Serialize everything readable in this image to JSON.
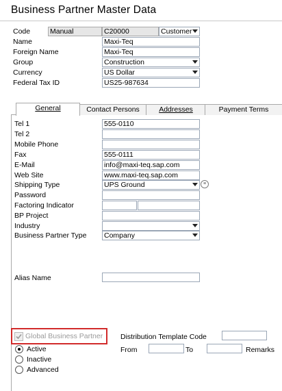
{
  "window": {
    "title": "Business Partner Master Data"
  },
  "header": {
    "code_label": "Code",
    "series_value": "Manual",
    "code_value": "C20000",
    "type_value": "Customer",
    "name_label": "Name",
    "name_value": "Maxi-Teq",
    "foreign_name_label": "Foreign Name",
    "foreign_name_value": "Maxi-Teq",
    "group_label": "Group",
    "group_value": "Construction",
    "currency_label": "Currency",
    "currency_value": "US Dollar",
    "tax_id_label": "Federal Tax ID",
    "tax_id_value": "US25-987634"
  },
  "tabs": [
    {
      "label": "General",
      "active": true
    },
    {
      "label": "Contact Persons",
      "active": false
    },
    {
      "label": "Addresses",
      "active": false
    },
    {
      "label": "Payment Terms",
      "active": false
    }
  ],
  "general": {
    "tel1_label": "Tel 1",
    "tel1_value": "555-0110",
    "tel2_label": "Tel 2",
    "tel2_value": "",
    "mobile_label": "Mobile Phone",
    "mobile_value": "",
    "fax_label": "Fax",
    "fax_value": "555-0111",
    "email_label": "E-Mail",
    "email_value": "info@maxi-teq.sap.com",
    "website_label": "Web Site",
    "website_value": "www.maxi-teq.sap.com",
    "shipping_label": "Shipping Type",
    "shipping_value": "UPS Ground",
    "password_label": "Password",
    "password_value": "",
    "factoring_label": "Factoring Indicator",
    "bp_project_label": "BP Project",
    "bp_project_value": "",
    "industry_label": "Industry",
    "industry_value": "",
    "bp_type_label": "Business Partner Type",
    "bp_type_value": "Company",
    "alias_label": "Alias Name",
    "alias_value": ""
  },
  "bottom": {
    "global_bp_label": "Global Business Partner",
    "global_bp_checked": true,
    "dist_template_label": "Distribution Template Code",
    "from_label": "From",
    "to_label": "To",
    "remarks_label": "Remarks",
    "status_options": [
      "Active",
      "Inactive",
      "Advanced"
    ],
    "status_selected": "Active"
  },
  "colors": {
    "highlight_box": "#d12a2a",
    "field_border": "#9aa6b6"
  }
}
